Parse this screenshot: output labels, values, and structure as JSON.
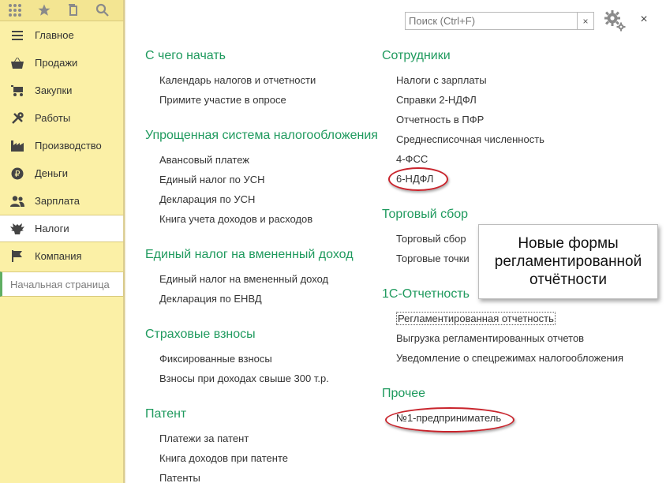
{
  "toolbar": {
    "icons": [
      "apps-grid-icon",
      "star-icon",
      "history-icon",
      "search-icon"
    ]
  },
  "sidebar": {
    "items": [
      {
        "label": "Главное",
        "icon": "menu-icon"
      },
      {
        "label": "Продажи",
        "icon": "basket-icon"
      },
      {
        "label": "Закупки",
        "icon": "cart-icon"
      },
      {
        "label": "Работы",
        "icon": "tools-icon"
      },
      {
        "label": "Производство",
        "icon": "factory-icon"
      },
      {
        "label": "Деньги",
        "icon": "ruble-coin-icon"
      },
      {
        "label": "Зарплата",
        "icon": "people-icon"
      },
      {
        "label": "Налоги",
        "icon": "eagle-emblem-icon"
      },
      {
        "label": "Компания",
        "icon": "flag-icon"
      }
    ],
    "active": "Налоги",
    "home_label": "Начальная страница"
  },
  "header": {
    "search_placeholder": "Поиск (Ctrl+F)",
    "clear_label": "×",
    "close_label": "×"
  },
  "sections_left": [
    {
      "title": "С чего начать",
      "links": [
        "Календарь налогов и отчетности",
        "Примите участие в опросе"
      ]
    },
    {
      "title": "Упрощенная система налогообложения",
      "links": [
        "Авансовый платеж",
        "Единый налог по УСН",
        "Декларация по УСН",
        "Книга учета доходов и расходов"
      ]
    },
    {
      "title": "Единый налог на вмененный доход",
      "links": [
        "Единый налог на вмененный доход",
        "Декларация по ЕНВД"
      ]
    },
    {
      "title": "Страховые взносы",
      "links": [
        "Фиксированные взносы",
        "Взносы при доходах свыше 300 т.р."
      ]
    },
    {
      "title": "Патент",
      "links": [
        "Платежи за патент",
        "Книга доходов при патенте",
        "Патенты"
      ]
    }
  ],
  "sections_right": [
    {
      "title": "Сотрудники",
      "links": [
        "Налоги с зарплаты",
        "Справки 2-НДФЛ",
        "Отчетность в ПФР",
        "Среднесписочная численность",
        "4-ФСС",
        "6-НДФЛ"
      ]
    },
    {
      "title": "Торговый сбор",
      "links": [
        "Торговый сбор",
        "Торговые точки"
      ]
    },
    {
      "title": "1С-Отчетность",
      "links": [
        "Регламентированная отчетность",
        "Выгрузка регламентированных отчетов",
        "Уведомление о спецрежимах налогообложения"
      ]
    },
    {
      "title": "Прочее",
      "links": [
        "№1-предприниматель"
      ]
    }
  ],
  "callout": {
    "text": "Новые формы регламентированной отчётности"
  },
  "colors": {
    "sidebar_bg": "#fbf0a6",
    "section_title": "#1f9a5e",
    "highlight_ellipse": "#c9242c"
  }
}
